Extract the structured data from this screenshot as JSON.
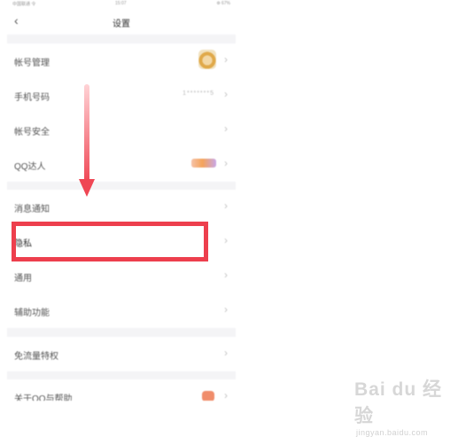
{
  "statusbar": {
    "carrier": "中国联通 令",
    "time": "15:07",
    "battery": "⊕ 67%"
  },
  "navbar": {
    "back_icon": "‹",
    "title": "设置"
  },
  "groups": [
    {
      "items": [
        {
          "label": "帐号管理",
          "trailing": "avatar"
        },
        {
          "label": "手机号码",
          "trailing": "masked",
          "value": "1*******5"
        },
        {
          "label": "帐号安全",
          "trailing": "none"
        },
        {
          "label": "QQ达人",
          "trailing": "badge"
        }
      ]
    },
    {
      "items": [
        {
          "label": "消息通知",
          "trailing": "none"
        },
        {
          "label": "隐私",
          "trailing": "none",
          "highlighted": true
        },
        {
          "label": "通用",
          "trailing": "none"
        },
        {
          "label": "辅助功能",
          "trailing": "none"
        }
      ]
    },
    {
      "items": [
        {
          "label": "免流量特权",
          "trailing": "none"
        }
      ]
    },
    {
      "items": [
        {
          "label": "关于QQ与帮助",
          "trailing": "badge2"
        }
      ]
    }
  ],
  "chevron": "›",
  "colors": {
    "highlight": "#ed3f4d",
    "background": "#f4f4f6",
    "row": "#ffffff"
  },
  "watermark": {
    "logo": "Bai du 经验",
    "url": "jingyan.baidu.com"
  }
}
